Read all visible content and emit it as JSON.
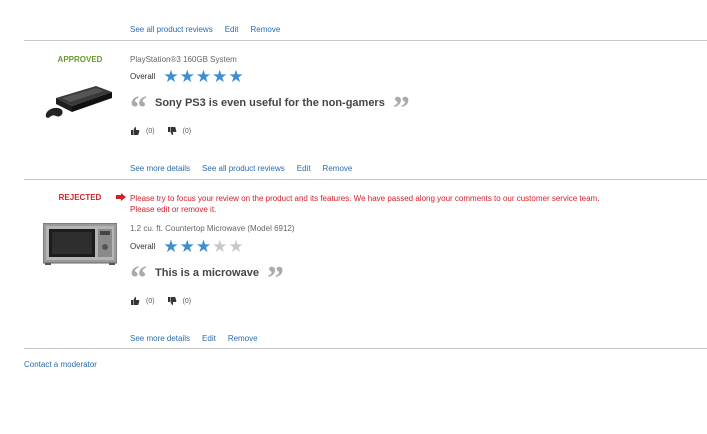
{
  "top_item": {
    "links": [
      "See all product reviews",
      "Edit",
      "Remove"
    ]
  },
  "reviews": [
    {
      "status": "APPROVED",
      "status_color": "#6a9a2c",
      "product": "PlayStation®3 160GB System",
      "overall_label": "Overall",
      "rating": 5,
      "rating_max": 5,
      "title": "Sony PS3 is even useful for the non-gamers",
      "helpful_yes": "(0)",
      "helpful_no": "(0)",
      "links": [
        "See more details",
        "See all product reviews",
        "Edit",
        "Remove"
      ]
    },
    {
      "status": "REJECTED",
      "status_color": "#d4202b",
      "warning_line1": "Please try to focus your review on the product and its features. We have passed along your comments to our customer service team.",
      "warning_line2_prefix": "Please ",
      "warning_edit": "edit",
      "warning_or": " or ",
      "warning_remove": "remove it",
      "warning_end": ".",
      "product": "1.2 cu. ft. Countertop Microwave (Model 6912)",
      "overall_label": "Overall",
      "rating": 3,
      "rating_max": 5,
      "title": "This is a microwave",
      "helpful_yes": "(0)",
      "helpful_no": "(0)",
      "links": [
        "See more details",
        "Edit",
        "Remove"
      ]
    }
  ],
  "footer": {
    "contact": "Contact a moderator"
  },
  "colors": {
    "link": "#2a6cb0",
    "star_on": "#3d8fd1",
    "star_off": "#c9c9c9"
  }
}
